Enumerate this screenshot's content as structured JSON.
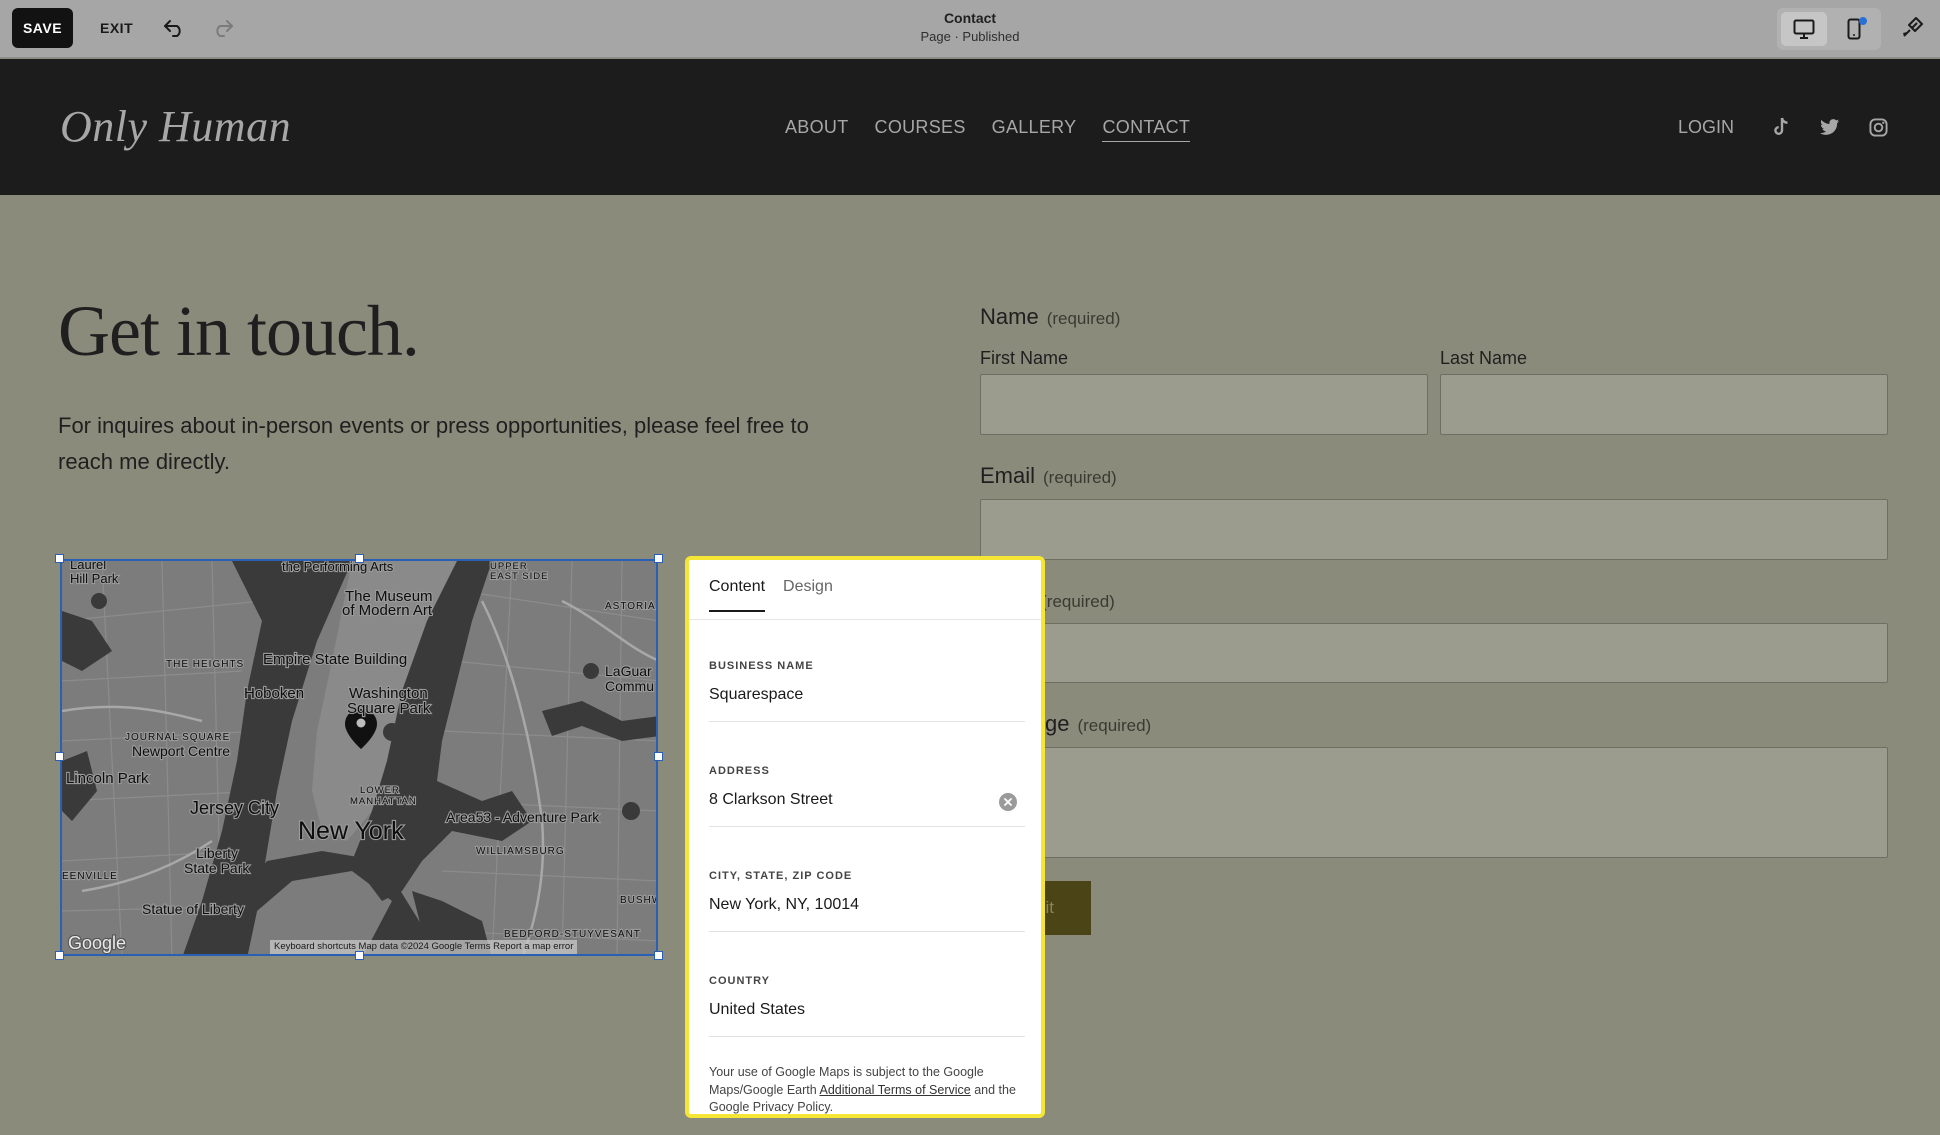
{
  "toolbar": {
    "save_label": "SAVE",
    "exit_label": "EXIT",
    "page_title": "Contact",
    "page_status": "Page · Published"
  },
  "site": {
    "logo": "Only Human",
    "nav": [
      "ABOUT",
      "COURSES",
      "GALLERY",
      "CONTACT"
    ],
    "active_nav": "CONTACT",
    "login": "LOGIN"
  },
  "main": {
    "headline": "Get in touch.",
    "intro": "For inquires about in-person events or press opportunities, please feel free to reach me directly."
  },
  "map": {
    "attribution": "Keyboard shortcuts   Map data ©2024 Google   Terms   Report a map error",
    "labels": {
      "performing_arts": "the Performing Arts",
      "upper_east": "UPPER EAST SIDE",
      "hill_park": "Hill Park",
      "laurel": "Laurel",
      "museum": "The Museum of Modern Art",
      "astoria": "ASTORIA",
      "heights": "THE HEIGHTS",
      "empire": "Empire State Building",
      "hoboken": "Hoboken",
      "washington": "Washington Square Park",
      "laguardia": "LaGuardia Commu",
      "journal": "JOURNAL SQUARE",
      "newport": "Newport Centre",
      "lincoln": "Lincoln Park",
      "lower_east": "LOWER MANHATTAN",
      "jersey": "Jersey City",
      "ny": "New York",
      "area53": "Area53 - Adventure Park",
      "williamsburg": "WILLIAMSBURG",
      "liberty_park": "Liberty State Park",
      "greenville": "EENVILLE",
      "statue": "Statue of Liberty",
      "bushwick": "BUSHW",
      "bedford": "BEDFORD-STUYVESANT",
      "google": "Google"
    }
  },
  "form": {
    "name_label": "Name",
    "name_req": "(required)",
    "first_name": "First Name",
    "last_name": "Last Name",
    "email_label": "Email",
    "email_req": "(required)",
    "subject_label": "ct",
    "subject_req": "(required)",
    "message_label": "ge",
    "message_req": "(required)",
    "submit_label": "nit"
  },
  "panel": {
    "tabs": [
      "Content",
      "Design"
    ],
    "active_tab": "Content",
    "business_name_label": "BUSINESS NAME",
    "business_name": "Squarespace",
    "address_label": "ADDRESS",
    "address": "8 Clarkson Street",
    "city_label": "CITY, STATE, ZIP CODE",
    "city": "New York, NY, 10014",
    "country_label": "COUNTRY",
    "country": "United States",
    "legal_pre": "Your use of Google Maps is subject to the Google Maps/Google Earth ",
    "legal_link1": "Additional Terms of Service",
    "legal_mid": " and the Google Privacy Policy."
  },
  "colors": {
    "highlight": "#f5e636",
    "selection": "#2a5fb8",
    "page_bg": "#8b8b7c",
    "header_bg": "#1c1c1c"
  }
}
